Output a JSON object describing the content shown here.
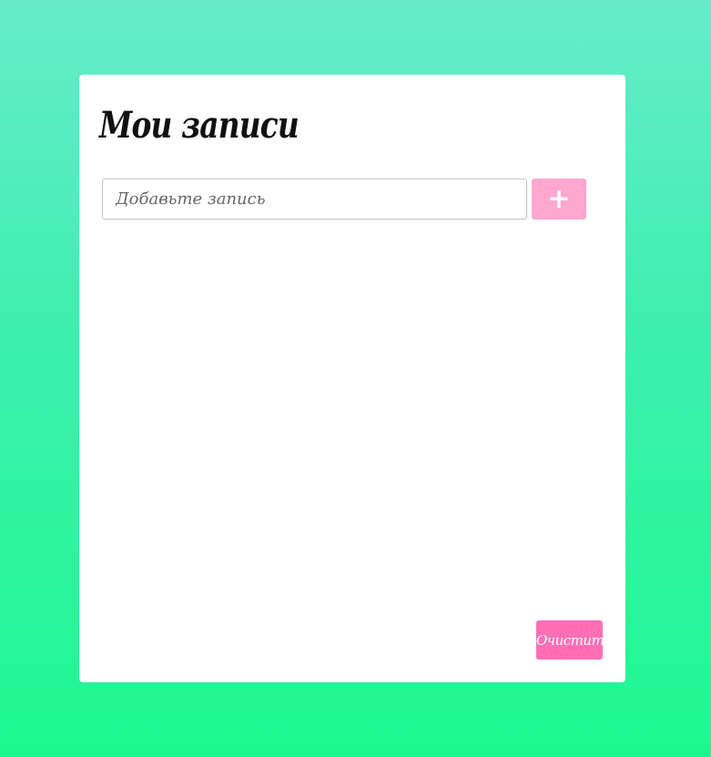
{
  "app": {
    "title": "Мои записи"
  },
  "composer": {
    "placeholder": "Добавьте запись",
    "value": "",
    "add_label": "+"
  },
  "notes": [],
  "footer": {
    "clear_label": "Очистить"
  },
  "colors": {
    "background_top": "#67ebcb",
    "background_bottom": "#1ef890",
    "card": "#ffffff",
    "add_button": "#ffa6d1",
    "clear_button": "#ff6fb6"
  }
}
